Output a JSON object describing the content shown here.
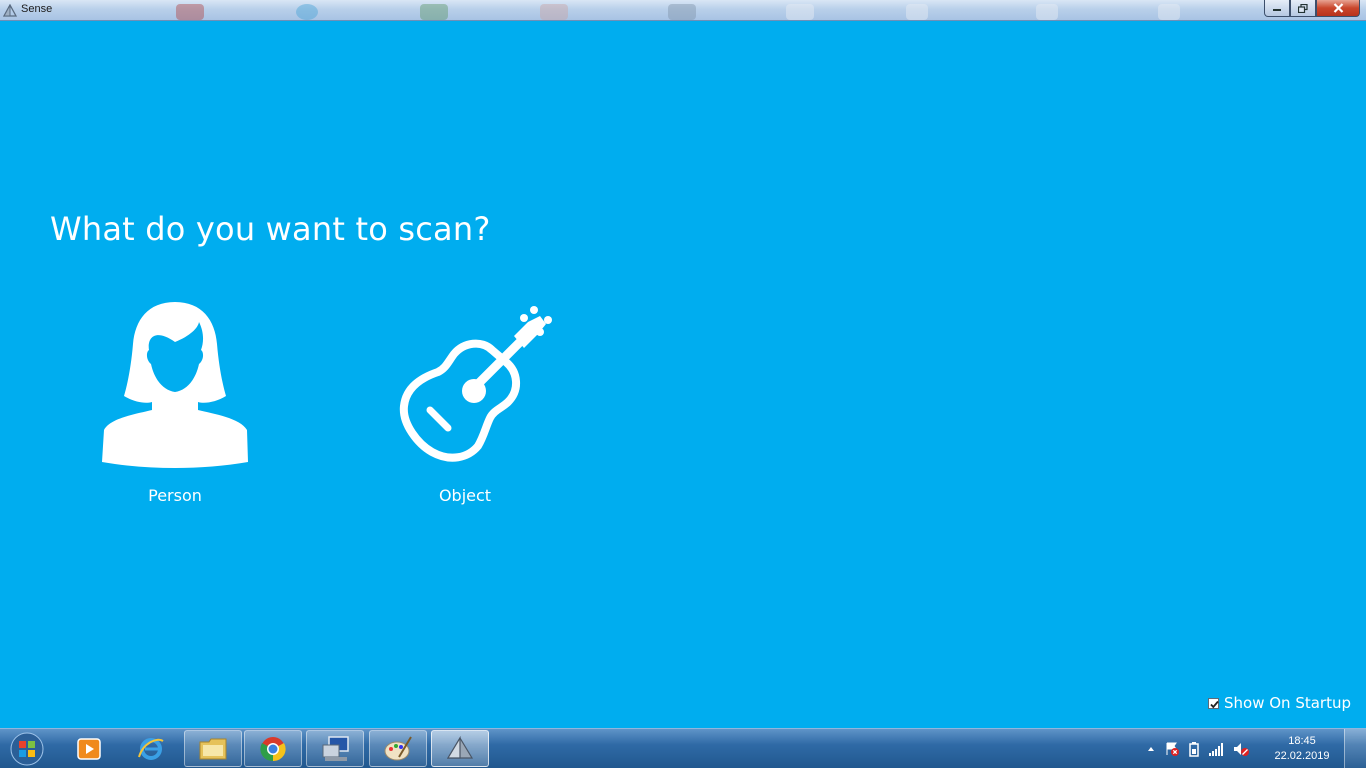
{
  "window": {
    "title": "Sense",
    "app_icon": "sense-3d-icon"
  },
  "main": {
    "heading": "What do you want to scan?",
    "options": [
      {
        "label": "Person",
        "icon": "person-icon"
      },
      {
        "label": "Object",
        "icon": "guitar-icon"
      }
    ],
    "show_on_startup": {
      "label": "Show On Startup",
      "checked": true
    }
  },
  "taskbar": {
    "pinned": [
      {
        "name": "media-player-icon"
      },
      {
        "name": "internet-explorer-icon"
      },
      {
        "name": "file-explorer-icon"
      },
      {
        "name": "chrome-icon"
      },
      {
        "name": "network-tool-icon"
      },
      {
        "name": "paint-icon"
      },
      {
        "name": "sense-3d-icon"
      }
    ],
    "clock": {
      "time": "18:45",
      "date": "22.02.2019"
    }
  },
  "colors": {
    "background": "#00adef",
    "text": "#ffffff"
  }
}
